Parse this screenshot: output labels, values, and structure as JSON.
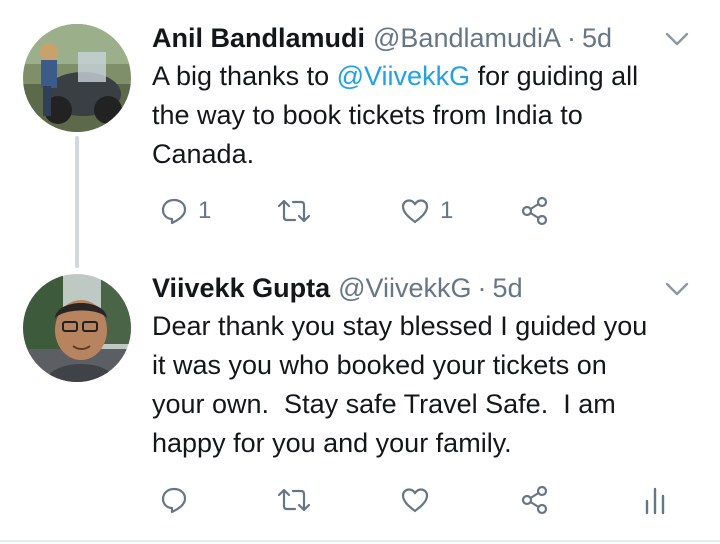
{
  "tweets": [
    {
      "display_name": "Anil Bandlamudi",
      "handle": "@BandlamudiA",
      "separator": "·",
      "time": "5d",
      "text_parts": [
        {
          "text": "A big thanks to ",
          "type": "plain"
        },
        {
          "text": "@ViivekkG",
          "type": "mention"
        },
        {
          "text": " for guiding all\nthe way to book tickets from India to\nCanada.",
          "type": "plain"
        }
      ],
      "reply_count": "1",
      "retweet_count": "",
      "like_count": "1",
      "icons": [
        "reply-icon",
        "retweet-icon",
        "like-icon",
        "share-icon"
      ]
    },
    {
      "display_name": "Viivekk Gupta",
      "handle": "@ViivekkG",
      "separator": "·",
      "time": "5d",
      "text": "Dear thank you stay blessed I guided you\nit was you who booked your tickets on\nyour own.  Stay safe Travel Safe.  I am\nhappy for you and your family.",
      "icons": [
        "reply-icon",
        "retweet-icon",
        "like-icon",
        "share-icon",
        "analytics-icon"
      ]
    }
  ],
  "colors": {
    "name": "#14171a",
    "secondary": "#657786",
    "mention": "#1da1f2",
    "thread_line": "#cfd9de"
  }
}
